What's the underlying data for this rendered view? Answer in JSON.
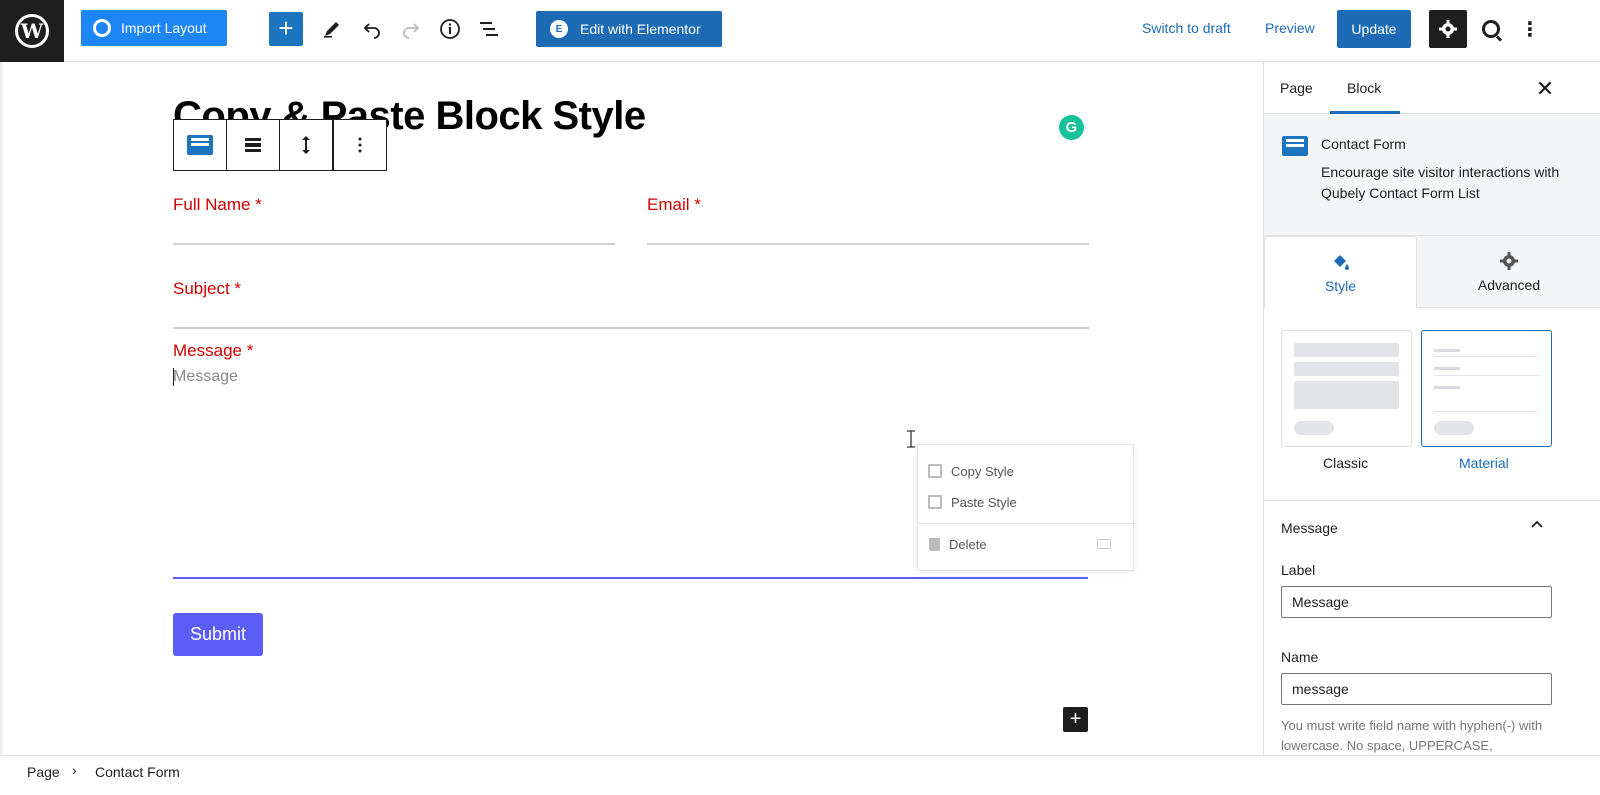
{
  "topbar": {
    "import_label": "Import Layout",
    "add_label": "+",
    "elementor_label": "Edit with Elementor",
    "switch_draft_label": "Switch to draft",
    "preview_label": "Preview",
    "update_label": "Update",
    "more_label": "⋮"
  },
  "editor": {
    "title": "Copy & Paste Block Style",
    "grammarly_label": "G",
    "fields": {
      "full_name_label": "Full Name *",
      "email_label": "Email *",
      "subject_label": "Subject *",
      "message_label": "Message *",
      "message_placeholder": "Message"
    },
    "submit_label": "Submit",
    "append_label": "+"
  },
  "context_menu": {
    "items": [
      {
        "label": "Copy Style",
        "icon": "copy-icon"
      },
      {
        "label": "Paste Style",
        "icon": "paste-icon"
      },
      {
        "label": "Delete",
        "icon": "trash-icon"
      }
    ]
  },
  "footer": {
    "breadcrumbs": [
      "Page",
      "Contact Form"
    ],
    "separator": "›"
  },
  "sidebar": {
    "tabs": [
      "Page",
      "Block"
    ],
    "active_tab": "Block",
    "close_label": "✕",
    "block": {
      "title": "Contact Form",
      "description": "Encourage site visitor interactions with Qubely Contact Form List"
    },
    "style_tabs": [
      "Style",
      "Advanced"
    ],
    "active_style_tab": "Style",
    "layouts": [
      "Classic",
      "Material"
    ],
    "selected_layout": "Material",
    "panel": {
      "title": "Message",
      "label_caption": "Label",
      "label_value": "Message",
      "name_caption": "Name",
      "name_value": "message",
      "help": "You must write field name with hyphen(-) with lowercase. No space, UPPERCASE,"
    }
  },
  "colors": {
    "accent": "#1d6bb5",
    "required_label": "#d10000",
    "submit": "#5b5ef4",
    "import_button": "#1e85f5"
  }
}
